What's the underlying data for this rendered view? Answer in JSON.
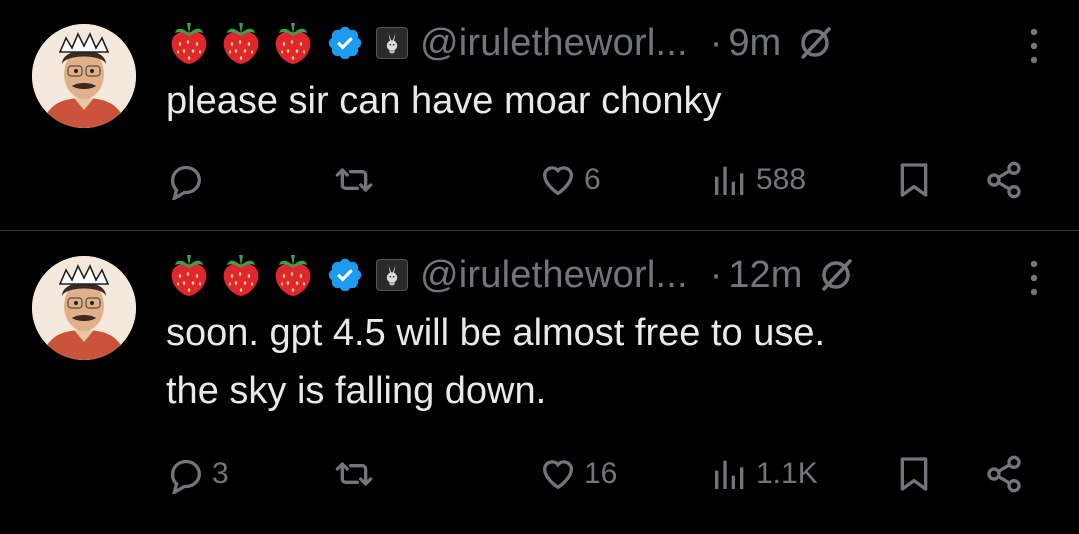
{
  "tweets": [
    {
      "handle": "@iruletheworl...",
      "time": "9m",
      "text": "please sir can have moar chonky",
      "replies": "",
      "retweets": "",
      "likes": "6",
      "views": "588"
    },
    {
      "handle": "@iruletheworl...",
      "time": "12m",
      "text_line1": "soon. gpt 4.5 will be almost free to use.",
      "text_line2": "the sky is falling down.",
      "replies": "3",
      "retweets": "",
      "likes": "16",
      "views": "1.1K"
    }
  ],
  "separator": "·",
  "icons": {
    "emoji": "strawberry-emoji",
    "verified": "verified-badge-icon",
    "affiliate": "rabbit-affiliate-badge",
    "grok": "grok-icon",
    "more": "more-vertical-icon",
    "reply": "reply-icon",
    "retweet": "retweet-icon",
    "like": "heart-icon",
    "views": "views-icon",
    "bookmark": "bookmark-icon",
    "share": "share-icon"
  },
  "colors": {
    "background": "#000000",
    "text": "#e7e9ea",
    "muted": "#71767b",
    "verified": "#1d9bf0",
    "strawberry": "#e0262f"
  }
}
